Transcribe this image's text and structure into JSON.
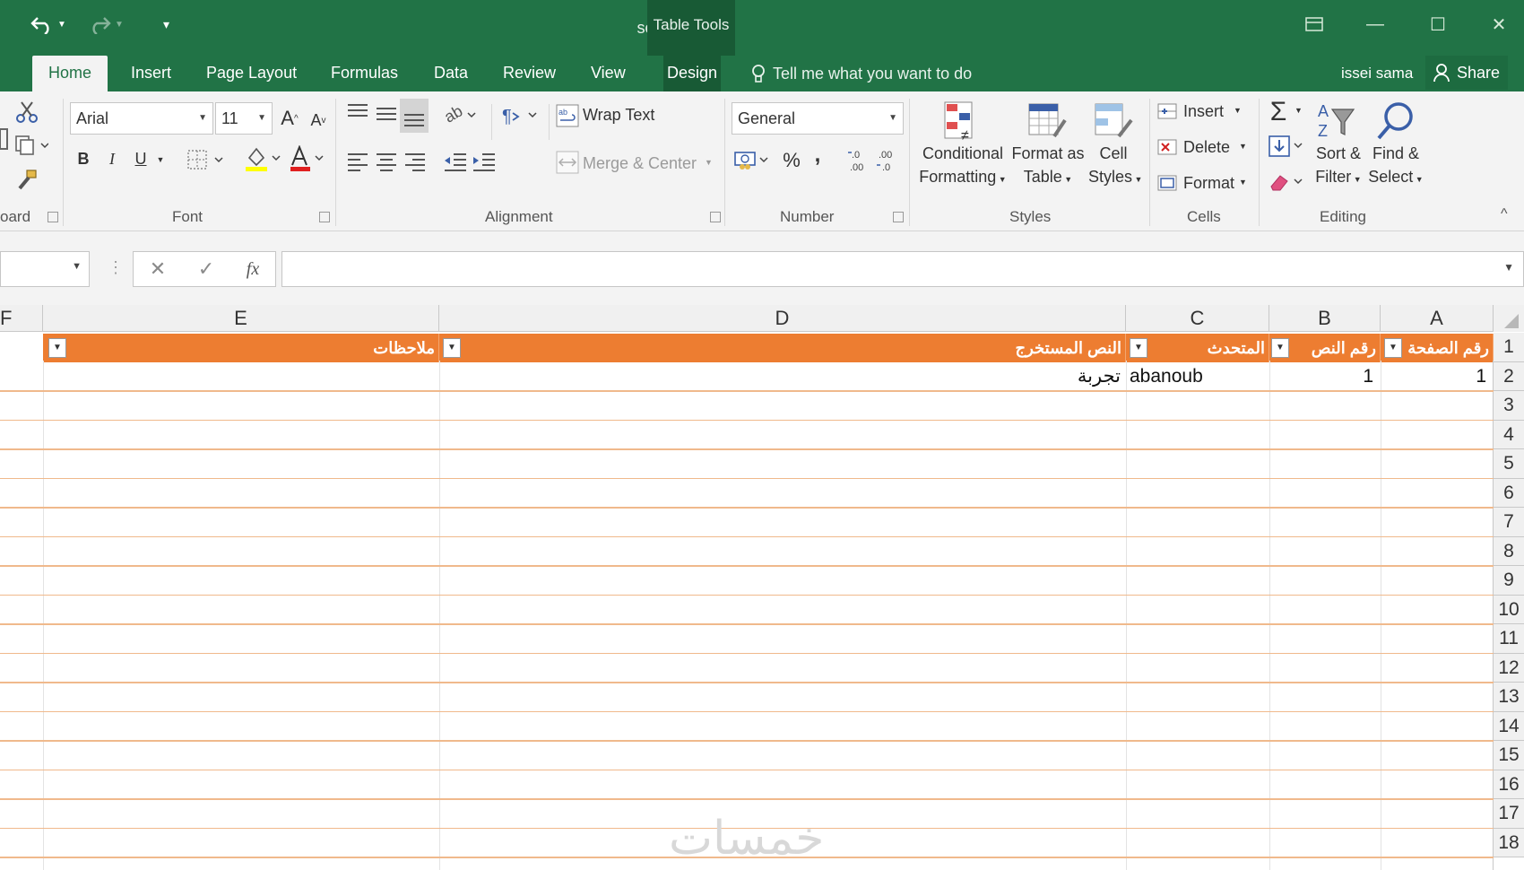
{
  "window": {
    "title": "scrpht - Excel",
    "contextual_tab_group": "Table Tools",
    "user_name": "issei sama",
    "share_label": "Share"
  },
  "tabs": [
    {
      "label": "Home",
      "active": true
    },
    {
      "label": "Insert"
    },
    {
      "label": "Page Layout"
    },
    {
      "label": "Formulas"
    },
    {
      "label": "Data"
    },
    {
      "label": "Review"
    },
    {
      "label": "View"
    },
    {
      "label": "Design"
    }
  ],
  "tell_me": "Tell me what you want to do",
  "ribbon": {
    "clipboard_label": "oard",
    "font": {
      "label": "Font",
      "font_name": "Arial",
      "font_size": "11",
      "bold": "B",
      "italic": "I",
      "underline": "U"
    },
    "alignment": {
      "label": "Alignment",
      "wrap_text": "Wrap Text",
      "merge_center": "Merge & Center"
    },
    "number": {
      "label": "Number",
      "format": "General",
      "percent": "%",
      "comma": ","
    },
    "styles": {
      "label": "Styles",
      "conditional_formatting": [
        "Conditional",
        "Formatting"
      ],
      "format_as_table": [
        "Format as",
        "Table"
      ],
      "cell_styles": [
        "Cell",
        "Styles"
      ]
    },
    "cells": {
      "label": "Cells",
      "insert": "Insert",
      "delete": "Delete",
      "format": "Format"
    },
    "editing": {
      "label": "Editing",
      "sort_filter": [
        "Sort &",
        "Filter"
      ],
      "find_select": [
        "Find &",
        "Select"
      ]
    }
  },
  "formula_bar": {
    "fx": "fx",
    "value": ""
  },
  "sheet": {
    "column_letters": [
      "E",
      "D",
      "C",
      "B",
      "A"
    ],
    "edge_column": "F",
    "header_row": [
      "ملاحظات",
      "النص المستخرج",
      "المتحدث",
      "رقم النص",
      "رقم الصفحة"
    ],
    "row2": [
      "",
      "تجربة",
      "abanoub",
      "1",
      "1"
    ],
    "row_numbers": [
      "1",
      "2",
      "3",
      "4",
      "5",
      "6",
      "7",
      "8",
      "9",
      "10",
      "11",
      "12",
      "13",
      "14",
      "15",
      "16",
      "17",
      "18"
    ]
  },
  "watermark": "خمسات",
  "colors": {
    "excel_green": "#217346",
    "table_header_orange": "#ed7d31",
    "row_border": "#f0b98c"
  }
}
